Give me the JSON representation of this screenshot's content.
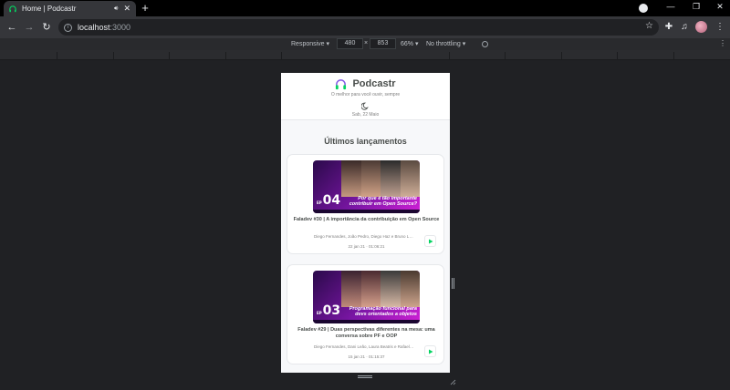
{
  "browser": {
    "tab_title": "Home | Podcastr",
    "url_host": "localhost",
    "url_port": ":3000"
  },
  "devtools": {
    "device": "Responsive",
    "width": "480",
    "times": "×",
    "height": "853",
    "zoom": "66%",
    "throttling": "No throttling"
  },
  "app": {
    "brand": "Podcastr",
    "tagline": "O melhor para você ouvir, sempre",
    "date": "Sab, 22 Maio",
    "section_title": "Últimos lançamentos",
    "episodes": [
      {
        "ep_number": "04",
        "thumb_text": "Por que é tão importante contribuir em Open Source?",
        "title": "Faladev #30 | A importância da contribuição em Open Source",
        "members": "Diego Fernandes, João Pedro, Diego Haz e Bruno Lemos",
        "meta": "22 jan 21 · 01:06:21"
      },
      {
        "ep_number": "03",
        "thumb_text": "Programação funcional para devs orientados a objetos",
        "title": "Faladev #29 | Duas perspectivas diferentes na mesa: uma conversa sobre PF e OOP",
        "members": "Diego Fernandes, Dani Leão, Laura Beatris e Rafael Camarda",
        "meta": "15 jan 21 · 01:15:37"
      }
    ]
  },
  "colors": {
    "accent": "#8257e5",
    "play_green": "#04d361",
    "text_dark": "#494d4b",
    "text_muted": "#808080"
  }
}
